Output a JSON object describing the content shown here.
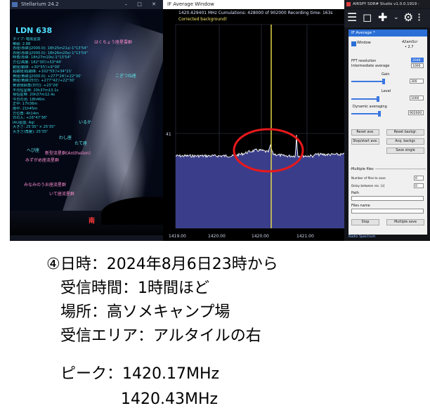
{
  "stellarium": {
    "window_title": "Stellarium 24.2",
    "constellation_name": "LDN 638",
    "info_lines": [
      "タイプ: 暗黒星雲",
      "等級: 2.88",
      "赤経/赤緯(J2000.0): 18h25m21s/-1°13'54\"",
      "赤経/赤緯(J2000.0): 18h26m20s/-1°13'54\"",
      "時角/赤緯: 18h27m10s/-1°13'54\"",
      "方位/高度: 182°30'/+53°44'",
      "銀経/銀緯: +30°55'/+9°00'",
      "超銀経/超銀緯: +102°55'/+34°21'",
      "黄経/黄緯(J2000.0): +277°24'/+22°30'",
      "黄経/黄緯(日付): +277°42'/+22°30'",
      "黄道傾斜角(日付): +23°26'",
      "平均恒星時: 20h37m13.1s",
      "視恒星時: 20h37m12.4s",
      "今日の出: 18h46m",
      "正中: 17h36m",
      "南中: 21h45m",
      "方位角: 4h14m",
      "日の入: +26°47'36\"",
      "IAU星座: Aql",
      "大きさ: 25'35\" × 25'35\"",
      "大きさ(角度): 25'35\""
    ],
    "sky_labels": {
      "label1": "はくちょう座星雲群",
      "label2": "こぎつね座",
      "label3": "いるか",
      "label4": "わし座",
      "label5": "たて座",
      "label6": "へび座",
      "label7": "新型流星群(Antihelion)",
      "label8": "みずがめ座流星群",
      "label9": "みなみのうお座流星群",
      "label10": "いて座流星群",
      "south_marker": "南"
    }
  },
  "if_window": {
    "title": "IF Average Window",
    "status_line": "1420.429401 MHz   Cumulations: 428000 of 902000   Recording time: 163s",
    "corrected_text": "Corrected background!",
    "y_tick": "41",
    "x_ticks": [
      "1419.00",
      "1420.00",
      "1420.00",
      "1421.00"
    ],
    "marker_freq_mhz": 1420.43,
    "highlight_color": "#e8181c",
    "marker_color": "#f0e24a"
  },
  "sdr_panel": {
    "window_title": "AIRSPY SDR# Studio v1.0.0.1919 -",
    "panel_title": "IF Average *",
    "window_checkbox_label": "Window",
    "window_value": "42amScr",
    "window_value2": "•  2.7",
    "fft_resolution_label": "FFT resolution",
    "intermediate_average_label": "Intermediate average",
    "fft_value": "2048",
    "intermediate_value": "1000",
    "gain_label": "Gain",
    "gain_value": "300",
    "level_label": "Level",
    "level_value": "1000",
    "dynamic_averaging_label": "Dynamic averaging",
    "dynamic_value": "902000",
    "buttons": {
      "reset_ave": "Reset ave.",
      "reset_backgr": "Reset backgr.",
      "stop_start_ave": "Stop/start ave.",
      "acq_backgr": "Acq. backgr.",
      "save_single": "Save single"
    },
    "multiple_files_label": "Multiple files",
    "number_of_files_label": "Number of files to save",
    "delay_label": "Delay between rec. [s]",
    "files_value": "0",
    "delay_value": "0",
    "path_label": "Path",
    "files_name_label": "Files name",
    "stop_button": "Stop",
    "multiple_save_button": "Multiple save",
    "footer_text": "Radio Spectrum"
  },
  "caption": {
    "line1": "④日時：2024年8月6日23時から",
    "line2": "受信時間：1時間ほど",
    "line3": "場所：高ソメキャンプ場",
    "line4": "受信エリア：アルタイルの右",
    "line5": "ピーク：1420.17MHz",
    "line6": "1420.43MHz"
  }
}
